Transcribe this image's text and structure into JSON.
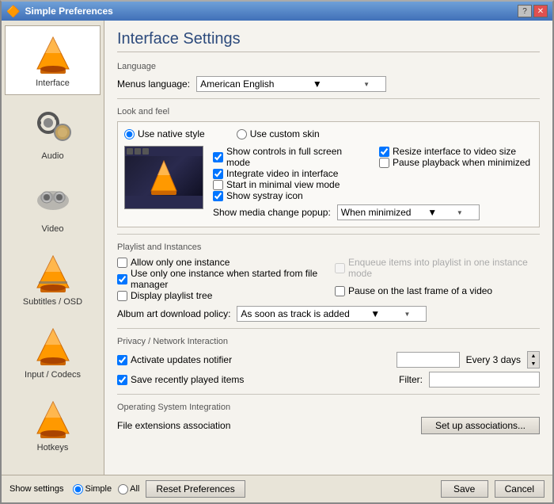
{
  "window": {
    "title": "Simple Preferences"
  },
  "sidebar": {
    "items": [
      {
        "id": "interface",
        "label": "Interface",
        "icon": "🔶",
        "active": true
      },
      {
        "id": "audio",
        "label": "Audio",
        "icon": "🎧"
      },
      {
        "id": "video",
        "label": "Video",
        "icon": "👓"
      },
      {
        "id": "subtitles",
        "label": "Subtitles / OSD",
        "icon": "👓"
      },
      {
        "id": "input",
        "label": "Input / Codecs",
        "icon": "🔶"
      },
      {
        "id": "hotkeys",
        "label": "Hotkeys",
        "icon": "🔶"
      }
    ]
  },
  "page": {
    "title": "Interface Settings",
    "language_section": "Language",
    "menus_language_label": "Menus language:",
    "menus_language_value": "American English",
    "look_feel_section": "Look and feel",
    "radio_native": "Use native style",
    "radio_custom": "Use custom skin",
    "cb_controls_fullscreen": "Show controls in full screen mode",
    "cb_integrate_video": "Integrate video in interface",
    "cb_minimal_view": "Start in minimal view mode",
    "cb_systray": "Show systray icon",
    "cb_resize_interface": "Resize interface to video size",
    "cb_pause_minimized": "Pause playback when minimized",
    "show_media_popup_label": "Show media change popup:",
    "show_media_popup_value": "When minimized",
    "playlist_section": "Playlist and Instances",
    "cb_one_instance": "Allow only one instance",
    "cb_one_instance_file_manager": "Use only one instance when started from file manager",
    "cb_enqueue": "Enqueue items into playlist in one instance mode",
    "cb_display_playlist": "Display playlist tree",
    "cb_pause_last": "Pause on the last frame of a video",
    "album_art_label": "Album art download policy:",
    "album_art_value": "As soon as track is added",
    "privacy_section": "Privacy / Network Interaction",
    "cb_updates": "Activate updates notifier",
    "update_period_value": "Every 3 days",
    "cb_recently_played": "Save recently played items",
    "filter_label": "Filter:",
    "os_section": "Operating System Integration",
    "file_extensions_label": "File extensions association",
    "setup_associations_btn": "Set up associations...",
    "show_settings_label": "Show settings",
    "radio_simple": "Simple",
    "radio_all": "All",
    "reset_btn": "Reset Preferences",
    "save_btn": "Save",
    "cancel_btn": "Cancel"
  }
}
